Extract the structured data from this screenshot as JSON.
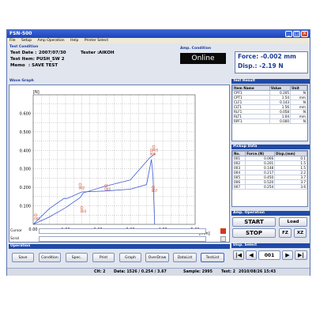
{
  "window": {
    "title": "FSN-500",
    "buttons": [
      "_",
      "□",
      "✕"
    ]
  },
  "menu": [
    "File",
    "Setup",
    "Amp Operation",
    "Help",
    "Printer Select"
  ],
  "test_condition": {
    "header": "Test Condition",
    "date_label": "Test Date :",
    "date": "2007/07/30",
    "tester_label": "Tester :",
    "tester": "AIKOH",
    "item_label": "Test Item:",
    "item": "PUSH_SW 2",
    "memo_label": "Memo",
    "memo": ": SAVE TEST"
  },
  "amp_condition": {
    "header": "Amp. Condition",
    "status": "Online"
  },
  "readout": {
    "force_label": "Force:",
    "force": "-0.002 mm",
    "disp_label": "Disp.:",
    "disp": "-2.19 N"
  },
  "wave_graph": {
    "header": "Wave Graph"
  },
  "chart_data": {
    "type": "line",
    "ylabel": "[N]",
    "xlabel": "[mm]",
    "xlim": [
      0,
      5.0
    ],
    "ylim": [
      0,
      0.7
    ],
    "x_ticks": [
      "0.00",
      "1.00",
      "2.00",
      "3.00",
      "4.00",
      "5.00"
    ],
    "y_ticks": [
      "0.100",
      "0.200",
      "0.300",
      "0.400",
      "0.500",
      "0.600"
    ],
    "grid": true,
    "series": [
      {
        "x": [
          0,
          0.5,
          0.95,
          1.05,
          1.5,
          2.2,
          3.0,
          3.5,
          3.65,
          3.7,
          3.75
        ],
        "y": [
          0.0,
          0.085,
          0.14,
          0.14,
          0.175,
          0.18,
          0.19,
          0.215,
          0.35,
          0.26,
          0.0
        ],
        "color": "#3d5bd4"
      },
      {
        "x": [
          0,
          0.5,
          1.0,
          1.45,
          1.55,
          2.2,
          3.0,
          3.6,
          3.75
        ],
        "y": [
          0.0,
          0.04,
          0.09,
          0.145,
          0.17,
          0.205,
          0.24,
          0.36,
          0.38
        ],
        "color": "#3d5bd4"
      }
    ],
    "markers": [
      {
        "x": 0.08,
        "y": 0.05,
        "label": "001"
      },
      {
        "x": 1.45,
        "y": 0.215,
        "label": "002"
      },
      {
        "x": 1.5,
        "y": 0.09,
        "label": "003"
      },
      {
        "x": 2.25,
        "y": 0.21,
        "label": "004"
      },
      {
        "x": 3.72,
        "y": 0.42,
        "label": "005"
      },
      {
        "x": 3.65,
        "y": 0.4,
        "label": "006"
      },
      {
        "x": 3.7,
        "y": 0.2,
        "label": "007"
      }
    ]
  },
  "test_result": {
    "header": "Test Result",
    "columns": [
      "Item Name",
      "Value",
      "Unit"
    ],
    "rows": [
      [
        "CPF1",
        "0.205",
        "N"
      ],
      [
        "CPT1",
        "1.54",
        "mm"
      ],
      [
        "CLF1",
        "0.143",
        "N"
      ],
      [
        "CLT1",
        "1.56",
        "mm"
      ],
      [
        "RLF1",
        "0.058",
        "N"
      ],
      [
        "RLT1",
        "1.04",
        "mm"
      ],
      [
        "RPF1",
        "0.000",
        "N"
      ]
    ]
  },
  "pickup_data": {
    "header": "Pickup Data",
    "columns": [
      "No.",
      "Force.(N)",
      "Disp.(mm)"
    ],
    "rows": [
      [
        "001",
        "0.066",
        "0.1"
      ],
      [
        "002",
        "0.201",
        "1.5"
      ],
      [
        "003",
        "0.148",
        "1.5"
      ],
      [
        "004",
        "0.217",
        "2.2"
      ],
      [
        "005",
        "0.450",
        "3.7"
      ],
      [
        "006",
        "0.520",
        "3.7"
      ],
      [
        "007",
        "0.254",
        "3.6"
      ]
    ]
  },
  "amp_operation": {
    "header": "Amp. Operation",
    "start": "START",
    "stop": "STOP",
    "load": "Load",
    "fz": "FZ",
    "xz": "XZ"
  },
  "disp_select": {
    "header": "Disp. Select",
    "value": "001"
  },
  "cursor_label": "Cursor",
  "scroll_label": "Scrol",
  "operation": {
    "header": "Operation",
    "buttons": [
      "Save",
      "Condition",
      "Spec.",
      "Print",
      "Graph",
      "OverDraw",
      "DataList",
      "TestList"
    ]
  },
  "status": {
    "ch": "CH: 2",
    "data": "Data: 1526 / 0.254 / 3.67",
    "sample": "Sample: 2995",
    "test": "Test: 2",
    "datetime": "2010/08/26 15:43"
  }
}
